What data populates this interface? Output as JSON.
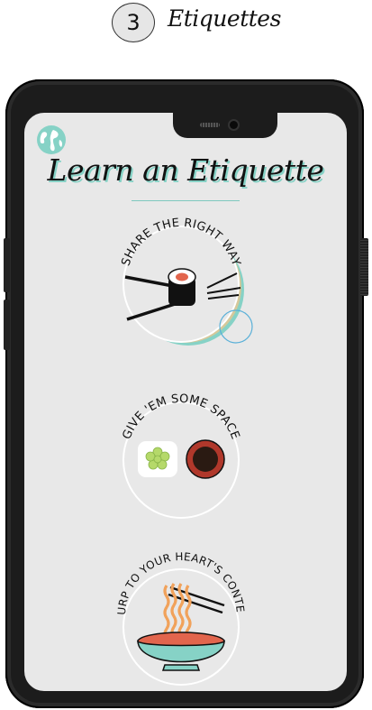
{
  "step": {
    "number": "3",
    "title": "Etiquettes"
  },
  "app": {
    "title": "Learn an Etiquette",
    "menu_icon": "globe-icon"
  },
  "etiquettes": [
    {
      "label": "SHARE THE RIGHT WAY",
      "icon": "sushi-chopsticks-icon"
    },
    {
      "label": "GIVE 'EM SOME SPACE",
      "icon": "wasabi-soy-sauce-icon"
    },
    {
      "label": "SLURP TO YOUR HEART'S CONTENT",
      "icon": "noodle-bowl-icon"
    }
  ],
  "colors": {
    "accent": "#86d2c6",
    "screen": "#e8e8e8",
    "bezel": "#1c1c1c"
  }
}
